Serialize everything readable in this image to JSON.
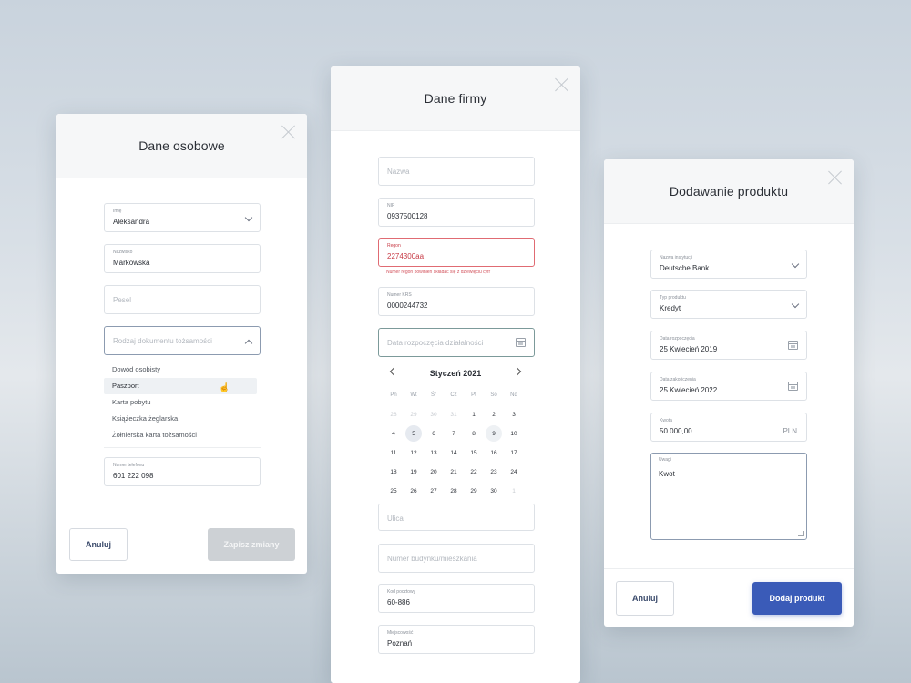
{
  "card1": {
    "title": "Dane osobowe",
    "fields": {
      "imie": {
        "label": "Imię",
        "value": "Aleksandra"
      },
      "nazwisko": {
        "label": "Nazwisko",
        "value": "Markowska"
      },
      "pesel": {
        "placeholder": "Pesel"
      },
      "rodzaj": {
        "placeholder": "Rodzaj dokumentu tożsamości"
      },
      "telefon": {
        "label": "Numer telefonu",
        "value": "601 222 098"
      }
    },
    "dropdown": [
      "Dowód osobisty",
      "Paszport",
      "Karta pobytu",
      "Książeczka żeglarska",
      "Żołnierska karta tożsamości"
    ],
    "buttons": {
      "cancel": "Anuluj",
      "save": "Zapisz zmiany"
    }
  },
  "card2": {
    "title": "Dane firmy",
    "fields": {
      "nazwa": {
        "placeholder": "Nazwa"
      },
      "nip": {
        "label": "NIP",
        "value": "0937500128"
      },
      "regon": {
        "label": "Regon",
        "value": "2274300aa",
        "error": "Numer regon powinien składać się z dziewięciu cyfr"
      },
      "krs": {
        "label": "Numer KRS",
        "value": "0000244732"
      },
      "data": {
        "placeholder": "Data rozpoczęcia działalności"
      },
      "ulica": {
        "placeholder": "Ulica"
      },
      "budynek": {
        "placeholder": "Numer budynku/mieszkania"
      },
      "kod": {
        "label": "Kod pocztowy",
        "value": "60-886"
      },
      "miejscowosc": {
        "label": "Miejscowość",
        "value": "Poznań"
      }
    },
    "calendar": {
      "month": "Styczeń 2021",
      "weekdays": [
        "Pn",
        "Wt",
        "Śr",
        "Cz",
        "Pt",
        "So",
        "Nd"
      ],
      "days": [
        "28",
        "29",
        "30",
        "31",
        "1",
        "2",
        "3",
        "4",
        "5",
        "6",
        "7",
        "8",
        "9",
        "10",
        "11",
        "12",
        "13",
        "14",
        "15",
        "16",
        "17",
        "18",
        "19",
        "20",
        "21",
        "22",
        "23",
        "24",
        "25",
        "26",
        "27",
        "28",
        "29",
        "30",
        "1"
      ],
      "muted_indices": [
        0,
        1,
        2,
        3,
        34
      ],
      "today_index": 8,
      "hover_index": 12
    }
  },
  "card3": {
    "title": "Dodawanie produktu",
    "fields": {
      "instytucja": {
        "label": "Nazwa instytucji",
        "value": "Deutsche Bank"
      },
      "typ": {
        "label": "Typ produktu",
        "value": "Kredyt"
      },
      "start": {
        "label": "Data rozpoczęcia",
        "value": "25 Kwiecień 2019"
      },
      "koniec": {
        "label": "Data zakończenia",
        "value": "25 Kwiecień 2022"
      },
      "kwota": {
        "label": "Kwota",
        "value": "50.000,00",
        "suffix": "PLN"
      },
      "uwagi": {
        "label": "Uwagi",
        "value": "Kwot"
      }
    },
    "buttons": {
      "cancel": "Anuluj",
      "add": "Dodaj produkt"
    }
  }
}
